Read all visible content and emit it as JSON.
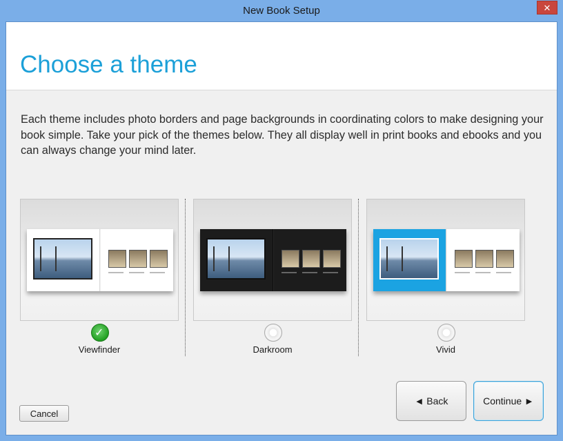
{
  "window": {
    "title": "New Book Setup"
  },
  "header": {
    "title": "Choose a theme"
  },
  "description": "Each theme includes photo borders and page backgrounds in coordinating colors to make designing your book simple. Take your pick of the themes below. They all display well in print books and ebooks and you can always change your mind later.",
  "themes": [
    {
      "label": "Viewfinder",
      "selected": true
    },
    {
      "label": "Darkroom",
      "selected": false
    },
    {
      "label": "Vivid",
      "selected": false
    }
  ],
  "buttons": {
    "back": "◄ Back",
    "continue": "Continue ►",
    "cancel": "Cancel"
  },
  "icons": {
    "close": "close-icon",
    "selected": "check-radio-icon",
    "unselected": "radio-icon"
  },
  "colors": {
    "accent": "#1ca0d8",
    "titlebar": "#7aaee8",
    "close": "#c9463d",
    "vivid": "#1ba3e2"
  }
}
